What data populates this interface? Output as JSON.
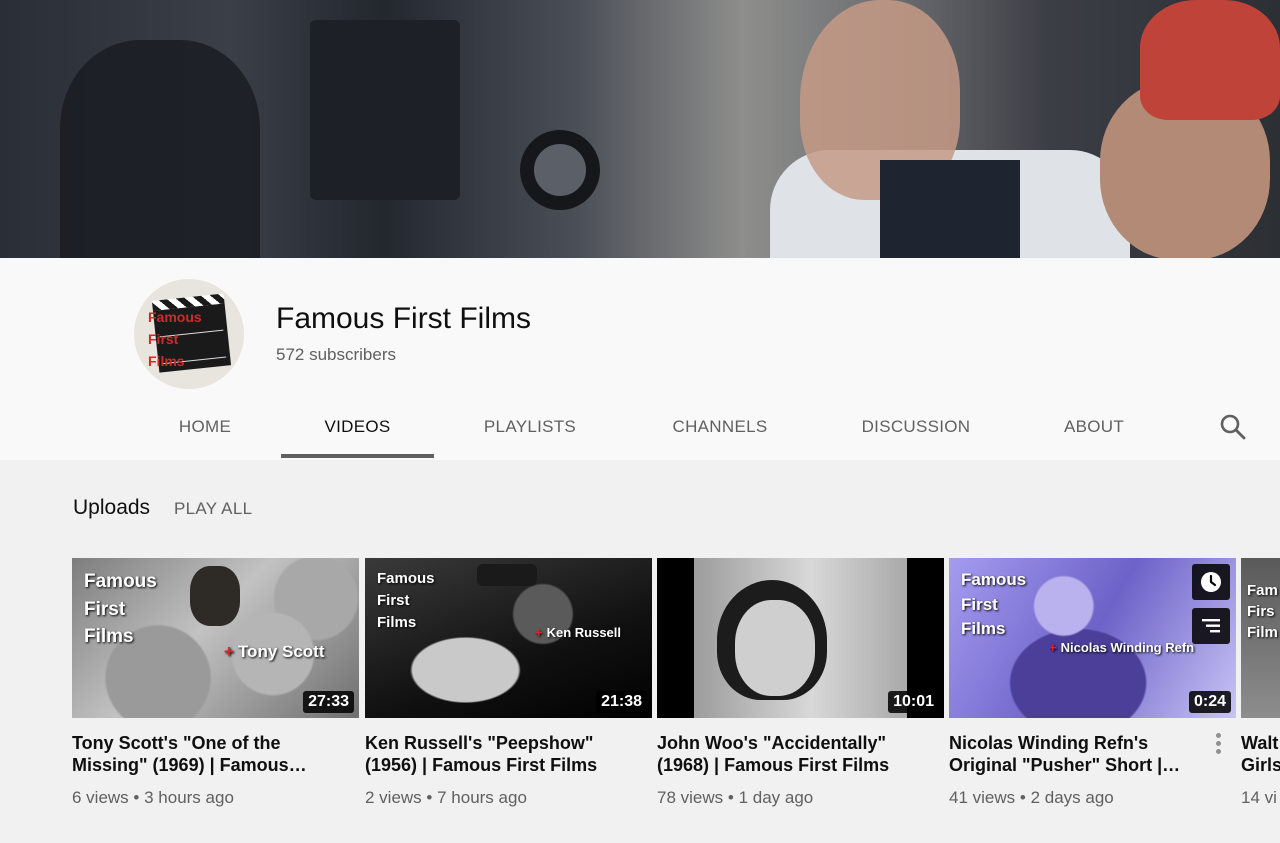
{
  "channel": {
    "name": "Famous First Films",
    "subscribers": "572 subscribers",
    "avatar_text": [
      "Famous",
      "First",
      "Films"
    ]
  },
  "tabs": [
    {
      "label": "HOME"
    },
    {
      "label": "VIDEOS",
      "active": true
    },
    {
      "label": "PLAYLISTS"
    },
    {
      "label": "CHANNELS"
    },
    {
      "label": "DISCUSSION"
    },
    {
      "label": "ABOUT"
    }
  ],
  "search_icon": "search-icon",
  "section": {
    "title": "Uploads",
    "play_all": "PLAY ALL"
  },
  "videos": [
    {
      "title": "Tony Scott's \"One of the Missing\" (1969) | Famous…",
      "views": "6 views",
      "age": "3 hours ago",
      "duration": "27:33",
      "watermark": [
        "Famous",
        "First",
        "Films"
      ],
      "director": "Tony Scott",
      "thumb_color": "#8b8b8b"
    },
    {
      "title": "Ken Russell's \"Peepshow\" (1956) | Famous First Films",
      "views": "2 views",
      "age": "7 hours ago",
      "duration": "21:38",
      "watermark": [
        "Famous",
        "First",
        "Films"
      ],
      "director": "Ken Russell",
      "thumb_color": "#2c2c2c"
    },
    {
      "title": "John Woo's \"Accidentally\" (1968) | Famous First Films",
      "views": "78 views",
      "age": "1 day ago",
      "duration": "10:01",
      "thumb_color": "#b9b9b9"
    },
    {
      "title": "Nicolas Winding Refn's Original \"Pusher\" Short |…",
      "views": "41 views",
      "age": "2 days ago",
      "duration": "0:24",
      "watermark": [
        "Famous",
        "First",
        "Films"
      ],
      "director": "Nicolas Winding Refn",
      "thumb_color": "#8a7fd6"
    },
    {
      "title": "Walt Girls",
      "views": "14 vi",
      "watermark": [
        "Fam",
        "Firs",
        "Film"
      ],
      "thumb_color": "#6b6b6b"
    }
  ],
  "meta_separator": "•"
}
